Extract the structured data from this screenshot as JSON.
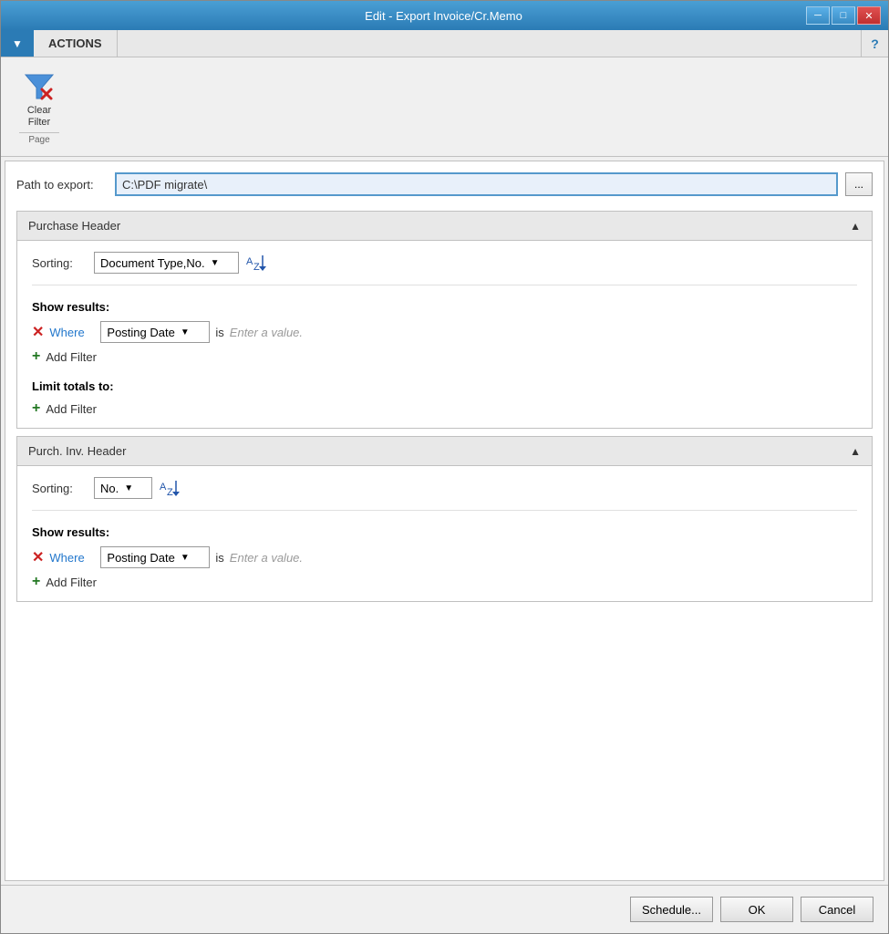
{
  "window": {
    "title": "Edit - Export Invoice/Cr.Memo",
    "min_label": "─",
    "max_label": "□",
    "close_label": "✕"
  },
  "ribbon": {
    "dropdown_arrow": "▼",
    "tab_actions": "ACTIONS",
    "help_icon": "?",
    "clear_filter_label": "Clear\nFilter",
    "page_label": "Page"
  },
  "path": {
    "label": "Path to export:",
    "value": "C:\\PDF migrate\\",
    "browse_label": "..."
  },
  "purchase_header": {
    "title": "Purchase Header",
    "sorting_label": "Sorting:",
    "sorting_value": "Document Type,No.",
    "show_results_label": "Show results:",
    "filter1_where": "Where",
    "filter1_field": "Posting Date",
    "filter1_is": "is",
    "filter1_value": "Enter a value.",
    "add_filter_label": "Add Filter",
    "limit_totals_label": "Limit totals to:",
    "limit_add_filter_label": "Add Filter"
  },
  "purch_inv_header": {
    "title": "Purch. Inv. Header",
    "sorting_label": "Sorting:",
    "sorting_value": "No.",
    "show_results_label": "Show results:",
    "filter1_where": "Where",
    "filter1_field": "Posting Date",
    "filter1_is": "is",
    "filter1_value": "Enter a value.",
    "add_filter_label": "Add Filter"
  },
  "footer": {
    "schedule_label": "Schedule...",
    "ok_label": "OK",
    "cancel_label": "Cancel"
  }
}
